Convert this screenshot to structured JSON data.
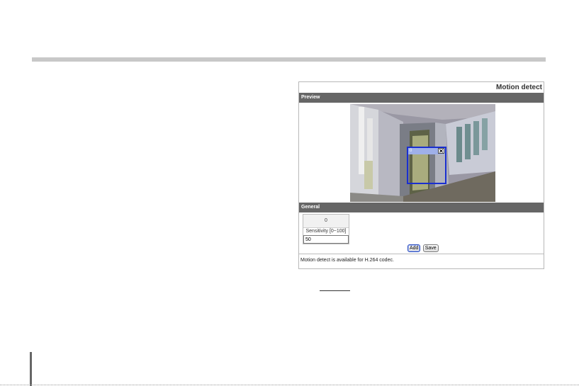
{
  "panel": {
    "title": "Motion detect",
    "preview_header": "Preview",
    "general_header": "General",
    "note": "Motion detect is available for H.264 codec."
  },
  "motion_window": {
    "label": "0",
    "close_symbol": "✕"
  },
  "general": {
    "window_index": "0",
    "sensitivity_label": "Sensitivity [0~100]",
    "sensitivity_value": "50",
    "add_label": "Add",
    "save_label": "Save"
  },
  "colors": {
    "header_bg": "#666666",
    "window_border": "#1a2fd0",
    "window_titlebar": "#9fb0e8"
  }
}
